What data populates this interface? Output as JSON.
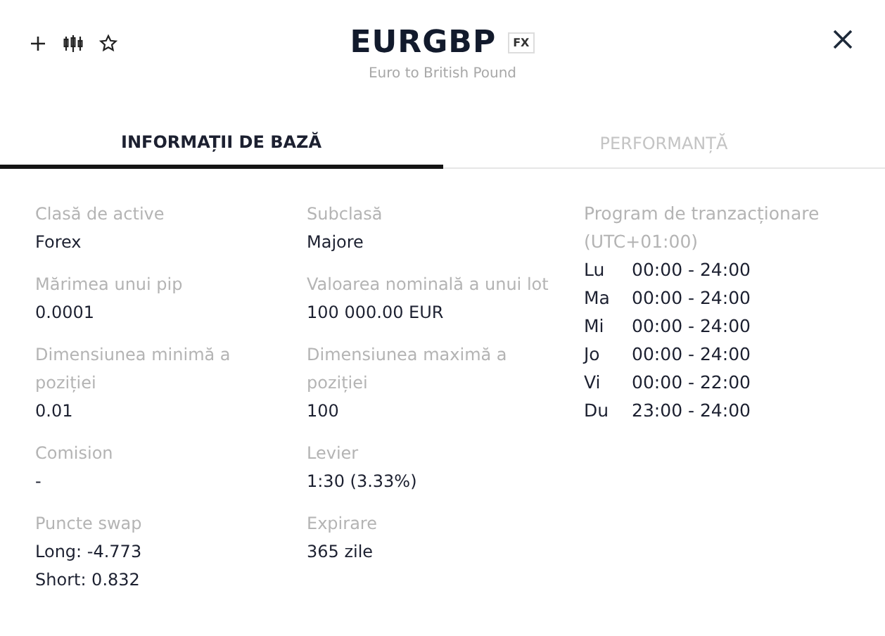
{
  "header": {
    "title": "EURGBP",
    "badge": "FX",
    "subtitle": "Euro to British Pound"
  },
  "tabs": [
    {
      "label": "INFORMAȚII DE BAZĂ",
      "selected": true
    },
    {
      "label": "PERFORMANȚĂ",
      "selected": false
    }
  ],
  "fields": [
    {
      "label": "Clasă de active",
      "values": [
        "Forex"
      ]
    },
    {
      "label": "Subclasă",
      "values": [
        "Majore"
      ]
    },
    {
      "label": "Mărimea unui pip",
      "values": [
        "0.0001"
      ]
    },
    {
      "label": "Valoarea nominală a unui lot",
      "values": [
        "100 000.00 EUR"
      ]
    },
    {
      "label": "Dimensiunea minimă a poziției",
      "values": [
        "0.01"
      ]
    },
    {
      "label": "Dimensiunea maximă a poziției",
      "values": [
        "100"
      ]
    },
    {
      "label": "Comision",
      "values": [
        "-"
      ]
    },
    {
      "label": "Levier",
      "values": [
        "1:30 (3.33%)"
      ]
    },
    {
      "label": "Puncte swap",
      "values": [
        "Long: -4.773",
        "Short: 0.832"
      ]
    },
    {
      "label": "Expirare",
      "values": [
        "365 zile"
      ]
    }
  ],
  "schedule": {
    "title": "Program de tranzacționare (UTC+01:00)",
    "days": [
      {
        "day": "Lu",
        "hours": "00:00 - 24:00"
      },
      {
        "day": "Ma",
        "hours": "00:00 - 24:00"
      },
      {
        "day": "Mi",
        "hours": "00:00 - 24:00"
      },
      {
        "day": "Jo",
        "hours": "00:00 - 24:00"
      },
      {
        "day": "Vi",
        "hours": "00:00 - 22:00"
      },
      {
        "day": "Du",
        "hours": "23:00 - 24:00"
      }
    ]
  }
}
